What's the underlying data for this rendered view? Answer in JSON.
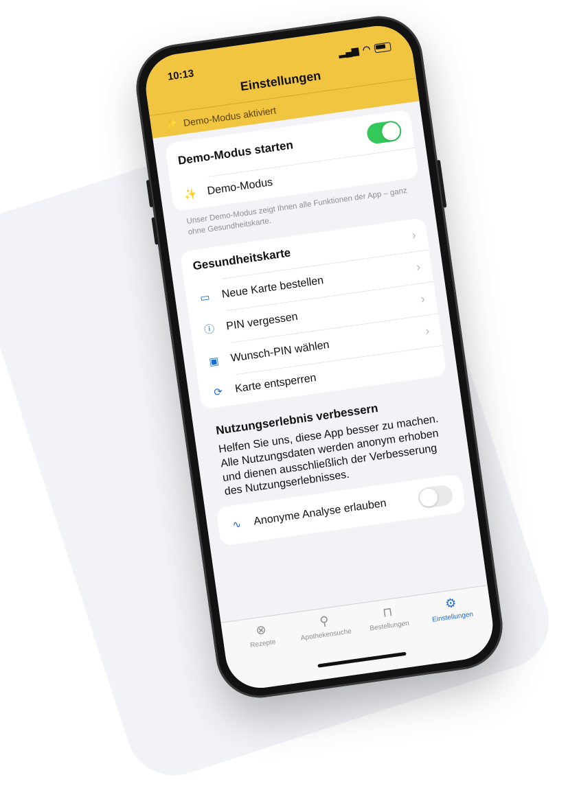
{
  "status_bar": {
    "time": "10:13"
  },
  "nav": {
    "title": "Einstellungen"
  },
  "demo_banner": {
    "text": "Demo-Modus aktiviert"
  },
  "demo_section": {
    "title": "Demo-Modus starten",
    "toggle_on": true,
    "row_label": "Demo-Modus",
    "footnote": "Unser Demo-Modus zeigt Ihnen alle Funktionen der App – ganz ohne Gesundheitskarte."
  },
  "health_card": {
    "title": "Gesundheitskarte",
    "items": [
      {
        "label": "Neue Karte bestellen",
        "icon": "card-icon"
      },
      {
        "label": "PIN vergessen",
        "icon": "question-icon"
      },
      {
        "label": "Wunsch-PIN wählen",
        "icon": "pin-card-icon"
      },
      {
        "label": "Karte entsperren",
        "icon": "unlock-icon"
      }
    ]
  },
  "usage": {
    "title": "Nutzungserlebnis verbessern",
    "text": "Helfen Sie uns, diese App besser zu machen. Alle Nutzungsdaten werden anonym erhoben und dienen ausschließlich der Verbesserung des Nutzungserlebnisses.",
    "analysis_label": "Anonyme Analyse erlauben",
    "analysis_on": false
  },
  "tabbar": {
    "tabs": [
      {
        "label": "Rezepte",
        "icon": "pill-icon",
        "active": false
      },
      {
        "label": "Apothekensuche",
        "icon": "map-pin-icon",
        "active": false
      },
      {
        "label": "Bestellungen",
        "icon": "bag-icon",
        "active": false
      },
      {
        "label": "Einstellungen",
        "icon": "gear-icon",
        "active": true
      }
    ]
  },
  "colors": {
    "accent": "#f1c540",
    "toggle_on": "#34c759",
    "link_blue": "#1c6bd8"
  }
}
